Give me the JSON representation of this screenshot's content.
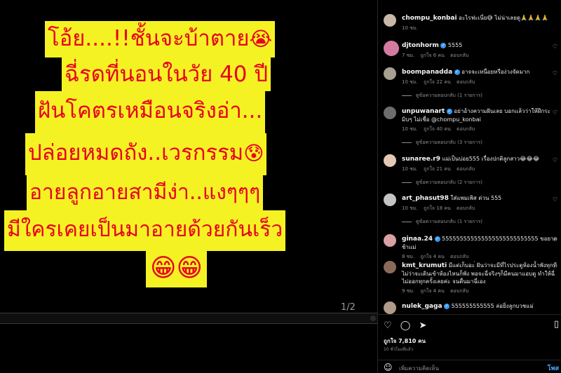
{
  "media": {
    "lines": [
      "โอ้ย....!!ชั้นจะบ้าตาย",
      "ฉี่รดที่นอนในวัย 40 ปี",
      "ฝันโคตรเหมือนจริงอ่า...",
      "ปล่อยหมดถัง..เวรกรรม",
      "อายลูกอายสามีง่า..แงๆๆๆ",
      "มีใครเคยเป็นมาอายด้วยกันเร็ว"
    ],
    "emojis": [
      "😭",
      "😰",
      "😁😁"
    ],
    "counter": "1/2"
  },
  "comments": [
    {
      "user": "chompu_konbai",
      "text": "อะไรฟะเนี่ย😅 ไม่น่าเลยดู🙏🙏🙏🙏",
      "time": "10 ชม.",
      "likes": "",
      "reply": "",
      "replies": "",
      "verified": false,
      "avatar_color": "#c9b8a8"
    },
    {
      "user": "djtonhorm",
      "text": "5555",
      "time": "7 ชม.",
      "likes": "ถูกใจ 6 คน",
      "reply": "ตอบกลับ",
      "replies": "",
      "verified": true,
      "avatar_color": "#d47aa0"
    },
    {
      "user": "boompanadda",
      "text": "อาจจะเหนื่อยหรือง่วงจัดมาก",
      "time": "10 ชม.",
      "likes": "ถูกใจ 22 คน",
      "reply": "ตอบกลับ",
      "replies": "ดูข้อความตอบกลับ (1 รายการ)",
      "verified": true,
      "avatar_color": "#a5a08f"
    },
    {
      "user": "unpuwanart",
      "text": "อย่าอ้างความฝันเลย บอกแล้วว่าให้ฝึกระมิบๆ ไม่เชื่อ @chompu_konbai",
      "time": "10 ชม.",
      "likes": "ถูกใจ 40 คน",
      "reply": "ตอบกลับ",
      "replies": "ดูข้อความตอบกลับ (3 รายการ)",
      "verified": true,
      "avatar_color": "#6d6d6d"
    },
    {
      "user": "sunaree.r9",
      "text": "แม่เป็นบ่อย555 เรื่องปกติลูกสาว😂😂😂",
      "time": "10 ชม.",
      "likes": "ถูกใจ 21 คน",
      "reply": "ตอบกลับ",
      "replies": "ดูข้อความตอบกลับ (2 รายการ)",
      "verified": false,
      "avatar_color": "#e3c9b5"
    },
    {
      "user": "art_phasut98",
      "text": "ใส่แพมเพิส ด่วน 555",
      "time": "10 ชม.",
      "likes": "ถูกใจ 18 คน",
      "reply": "ตอบกลับ",
      "replies": "ดูข้อความตอบกลับ (1 รายการ)",
      "verified": false,
      "avatar_color": "#c4c4c4"
    },
    {
      "user": "ginaa.24",
      "text": "555555555555555555555555555 ขอยาดช้าแม่",
      "time": "8 ชม.",
      "likes": "ถูกใจ 4 คน",
      "reply": "ตอบกลับ",
      "replies": "",
      "verified": true,
      "avatar_color": "#d9a0a5"
    },
    {
      "user": "kmt_krumuti",
      "text": "มีแต่เก็บอะ่ ฝันว่าจะมีที่ไรประตูห้องน้ำพังทุกที ไม่ว่าจะเดินเข้าห้องไหนก็พัง พอจะฉี่จริงๆก็มีคนมาแอบดู ทำให้ฉี่ไม่ออกทุกครั้งเลยค่ะ จนตื่นมาฉี่เอง",
      "time": "9 ชม.",
      "likes": "ถูกใจ 4 คน",
      "reply": "ตอบกลับ",
      "replies": "",
      "verified": false,
      "avatar_color": "#8a6a5a"
    },
    {
      "user": "nulek_gaga",
      "text": "555555555555 ล่อยิ่งลูกบวชแม่",
      "time": "",
      "likes": "",
      "reply": "",
      "replies": "",
      "verified": true,
      "avatar_color": "#b09a8a"
    }
  ],
  "actions": {
    "likes": "ถูกใจ 7,810 คน",
    "date": "10 ชั่วโมงที่แล้ว",
    "comment_placeholder": "เพิ่มความคิดเห็น",
    "post_label": "โพส"
  }
}
